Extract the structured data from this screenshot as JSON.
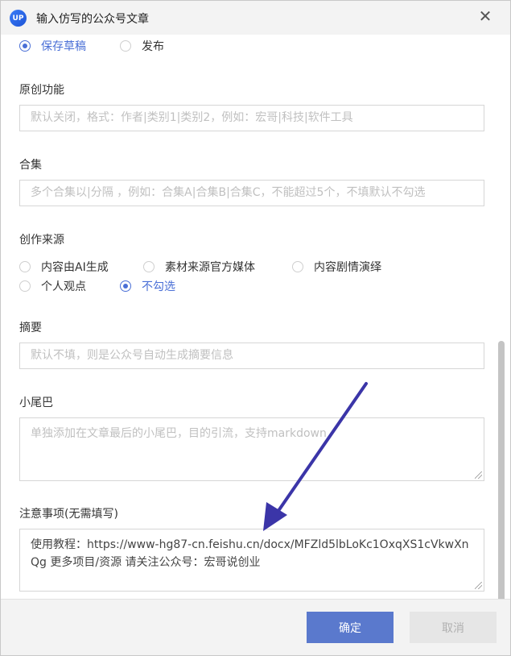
{
  "window": {
    "title": "输入仿写的公众号文章",
    "icon_text": "UP",
    "close_glyph": "✕"
  },
  "publish": {
    "options": [
      {
        "label": "保存草稿",
        "checked": true
      },
      {
        "label": "发布",
        "checked": false
      }
    ]
  },
  "original": {
    "label": "原创功能",
    "placeholder": "默认关闭，格式：作者|类别1|类别2，例如：宏哥|科技|软件工具"
  },
  "collection": {
    "label": "合集",
    "placeholder": "多个合集以|分隔 ，例如：合集A|合集B|合集C，不能超过5个，不填默认不勾选"
  },
  "source": {
    "label": "创作来源",
    "options": [
      {
        "label": "内容由AI生成",
        "checked": false
      },
      {
        "label": "素材来源官方媒体",
        "checked": false
      },
      {
        "label": "内容剧情演绎",
        "checked": false
      },
      {
        "label": "个人观点",
        "checked": false
      },
      {
        "label": "不勾选",
        "checked": true
      }
    ]
  },
  "summary": {
    "label": "摘要",
    "placeholder": "默认不填，则是公众号自动生成摘要信息"
  },
  "tail": {
    "label": "小尾巴",
    "placeholder": "单独添加在文章最后的小尾巴，目的引流，支持markdown"
  },
  "notes": {
    "label": "注意事项(无需填写)",
    "value": "使用教程：https://www-hg87-cn.feishu.cn/docx/MFZld5lbLoKc1OxqXS1cVkwXnQg  更多项目/资源 请关注公众号：宏哥说创业"
  },
  "footer": {
    "ok_label": "确定",
    "cancel_label": "取消"
  },
  "colors": {
    "accent": "#4a6fd6",
    "ok_button": "#5a79cd",
    "arrow": "#3b35a8"
  }
}
